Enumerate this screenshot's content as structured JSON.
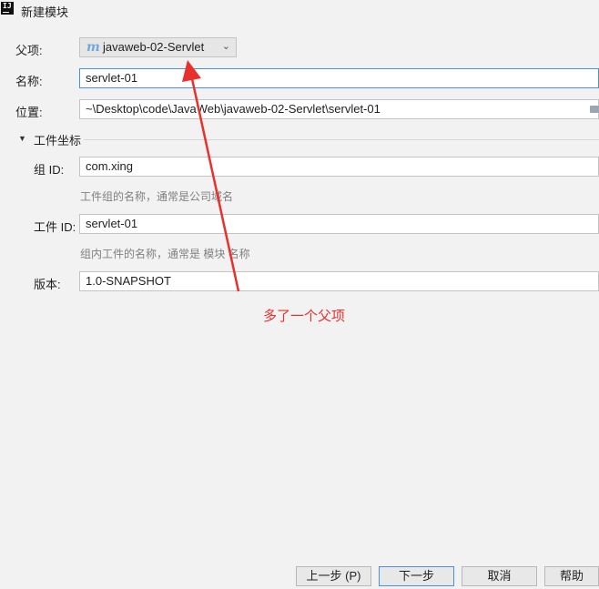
{
  "window": {
    "title": "新建模块",
    "app_icon": "IJ"
  },
  "form": {
    "parent_label": "父项:",
    "parent_value": "javaweb-02-Servlet",
    "parent_icon": "maven-m-icon",
    "name_label": "名称:",
    "name_value": "servlet-01",
    "location_label": "位置:",
    "location_value": "~\\Desktop\\code\\JavaWeb\\javaweb-02-Servlet\\servlet-01",
    "artifact_coords": {
      "title": "工件坐标",
      "group_label": "组 ID:",
      "group_value": "com.xing",
      "group_hint": "工件组的名称，通常是公司域名",
      "artifact_label": "工件 ID:",
      "artifact_value": "servlet-01",
      "artifact_hint": "组内工件的名称，通常是 模块 名称",
      "version_label": "版本:",
      "version_value": "1.0-SNAPSHOT"
    }
  },
  "annotation": {
    "text": "多了一个父项",
    "color": "#e8312c"
  },
  "buttons": {
    "prev": "上一步 (P)",
    "next": "下一步",
    "cancel": "取消",
    "help": "帮助"
  },
  "colors": {
    "focus": "#4a8fe2",
    "annotation_red": "#e8312c"
  }
}
